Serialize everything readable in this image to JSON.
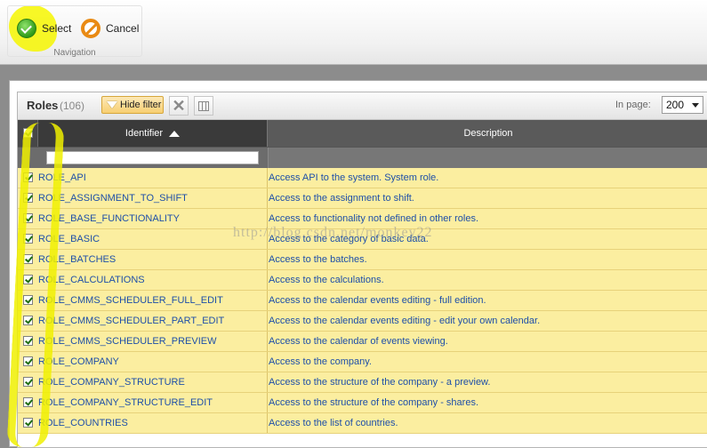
{
  "toolbar": {
    "select_label": "Select",
    "cancel_label": "Cancel",
    "group_caption": "Navigation"
  },
  "grid": {
    "title": "Roles",
    "count": "(106)",
    "hide_filter_label": "Hide filter",
    "in_page_label": "In page:",
    "in_page_value": "200",
    "columns": {
      "identifier": "Identifier",
      "description": "Description"
    },
    "sort": {
      "column": "identifier",
      "direction": "ascending"
    },
    "filter_value": ""
  },
  "rows": [
    {
      "id": "ROLE_API",
      "desc": "Access API to the system. System role.",
      "checked": true
    },
    {
      "id": "ROLE_ASSIGNMENT_TO_SHIFT",
      "desc": "Access to the assignment to shift.",
      "checked": true
    },
    {
      "id": "ROLE_BASE_FUNCTIONALITY",
      "desc": "Access to functionality not defined in other roles.",
      "checked": true
    },
    {
      "id": "ROLE_BASIC",
      "desc": "Access to the category of basic data.",
      "checked": true
    },
    {
      "id": "ROLE_BATCHES",
      "desc": "Access to the batches.",
      "checked": true
    },
    {
      "id": "ROLE_CALCULATIONS",
      "desc": "Access to the calculations.",
      "checked": true
    },
    {
      "id": "ROLE_CMMS_SCHEDULER_FULL_EDIT",
      "desc": "Access to the calendar events editing - full edition.",
      "checked": true
    },
    {
      "id": "ROLE_CMMS_SCHEDULER_PART_EDIT",
      "desc": "Access to the calendar events editing - edit your own calendar.",
      "checked": true
    },
    {
      "id": "ROLE_CMMS_SCHEDULER_PREVIEW",
      "desc": "Access to the calendar of events viewing.",
      "checked": true
    },
    {
      "id": "ROLE_COMPANY",
      "desc": "Access to the company.",
      "checked": true
    },
    {
      "id": "ROLE_COMPANY_STRUCTURE",
      "desc": "Access to the structure of the company - a preview.",
      "checked": true
    },
    {
      "id": "ROLE_COMPANY_STRUCTURE_EDIT",
      "desc": "Access to the structure of the company - shares.",
      "checked": true
    },
    {
      "id": "ROLE_COUNTRIES",
      "desc": "Access to the list of countries.",
      "checked": true
    }
  ],
  "watermark": "http://blog.csdn.net/monkey22",
  "colors": {
    "row_selected": "#fbeea0",
    "link_text": "#1e4fa8",
    "header_dark": "#3a3a3a",
    "highlighter": "#f6f600"
  }
}
